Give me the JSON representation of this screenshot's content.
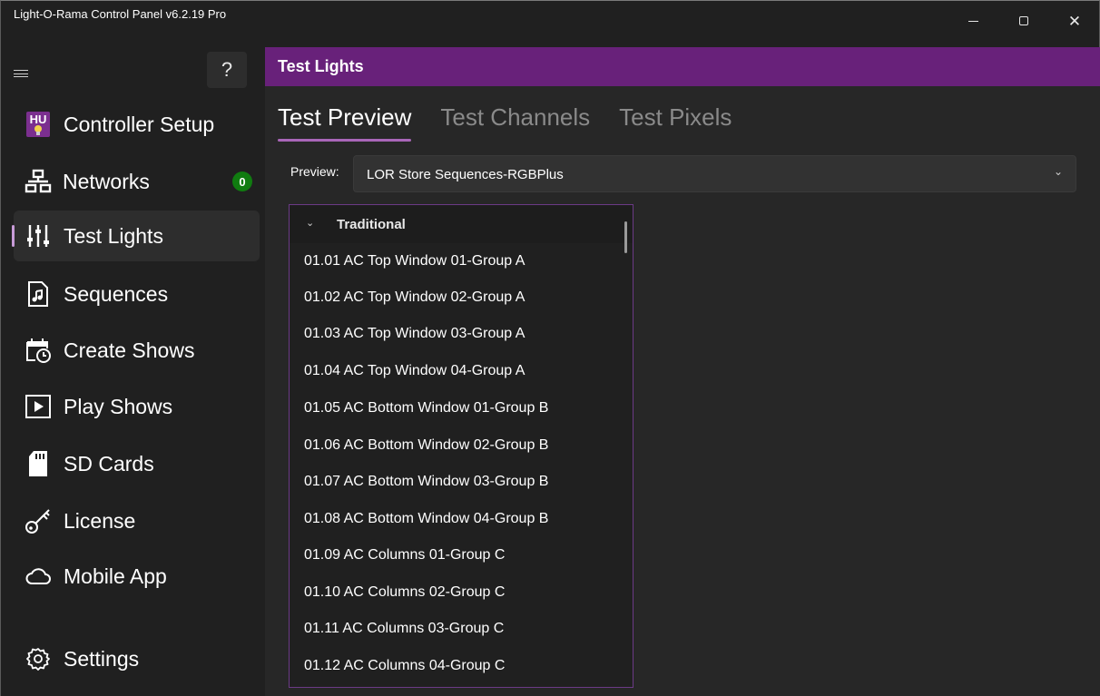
{
  "window": {
    "title": "Light-O-Rama Control Panel v6.2.19 Pro",
    "minimize_icon": "minimize-icon",
    "maximize_icon": "maximize-icon",
    "close_glyph": "✕"
  },
  "sidebar": {
    "help_label": "?",
    "items": [
      {
        "label": "Controller Setup",
        "icon": "hardware-utility-icon"
      },
      {
        "label": "Networks",
        "icon": "network-icon",
        "badge": "0"
      },
      {
        "label": "Test Lights",
        "icon": "sliders-icon",
        "selected": true
      },
      {
        "label": "Sequences",
        "icon": "music-file-icon"
      },
      {
        "label": "Create Shows",
        "icon": "calendar-clock-icon"
      },
      {
        "label": "Play Shows",
        "icon": "play-icon"
      },
      {
        "label": "SD Cards",
        "icon": "sd-card-icon"
      },
      {
        "label": "License",
        "icon": "key-icon"
      },
      {
        "label": "Mobile App",
        "icon": "cloud-icon"
      },
      {
        "label": "Settings",
        "icon": "gear-icon"
      }
    ],
    "colors": {
      "accent": "#c89bd8",
      "badge": "#107c10"
    }
  },
  "main": {
    "header_title": "Test Lights",
    "header_color": "#68217a",
    "tabs": [
      {
        "label": "Test Preview",
        "active": true
      },
      {
        "label": "Test Channels"
      },
      {
        "label": "Test Pixels"
      }
    ],
    "preview": {
      "label": "Preview:",
      "value": "LOR Store Sequences-RGBPlus"
    },
    "list": {
      "group": "Traditional",
      "items": [
        "01.01 AC Top Window 01-Group A",
        "01.02 AC Top Window 02-Group A",
        "01.03 AC Top Window 03-Group A",
        "01.04 AC Top Window 04-Group A",
        "01.05 AC Bottom Window 01-Group B",
        "01.06 AC Bottom Window 02-Group B",
        "01.07 AC Bottom Window 03-Group B",
        "01.08 AC Bottom Window 04-Group B",
        "01.09 AC Columns 01-Group C",
        "01.10 AC Columns 02-Group C",
        "01.11 AC Columns 03-Group C",
        "01.12 AC Columns 04-Group C"
      ]
    }
  }
}
